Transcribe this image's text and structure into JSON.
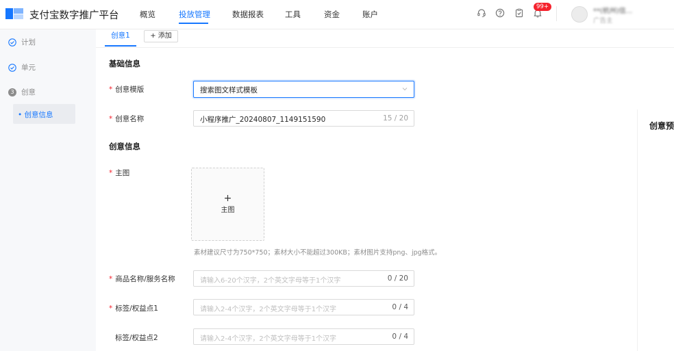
{
  "app": {
    "brand": "支付宝数字推广平台"
  },
  "nav": {
    "items": [
      {
        "label": "概览"
      },
      {
        "label": "投放管理",
        "active": true
      },
      {
        "label": "数据报表"
      },
      {
        "label": "工具"
      },
      {
        "label": "资金"
      },
      {
        "label": "账户"
      }
    ]
  },
  "top_icons": {
    "support": "headset-icon",
    "help": "question-icon",
    "tasks": "clipboard-check-icon",
    "notifications": "bell-icon",
    "badge": "99+"
  },
  "account": {
    "name": "**(杭州)信...",
    "role": "广告主"
  },
  "sidebar": {
    "steps": [
      {
        "label": "计划",
        "state": "done"
      },
      {
        "label": "单元",
        "state": "done"
      },
      {
        "label": "创意",
        "state": "current",
        "num": "3"
      }
    ],
    "sub_item": "• 创意信息"
  },
  "tabs": {
    "active": "创意1",
    "add": "+ 添加"
  },
  "basic": {
    "title": "基础信息",
    "template_label": "创意模版",
    "template_value": "搜索图文样式模板",
    "name_label": "创意名称",
    "name_value": "小程序推广_20240807_1149151590",
    "name_count": "15 / 20"
  },
  "creative": {
    "title": "创意信息",
    "main_image_label": "主图",
    "upload_plus": "+",
    "upload_label": "主图",
    "upload_hint": "素材建议尺寸为750*750；素材大小不能超过300KB；素材图片支持png、jpg格式。",
    "product_label": "商品名称/服务名称",
    "product_placeholder": "请输入6-20个汉字，2个英文字母等于1个汉字",
    "product_count": "0 / 20",
    "tag1_label": "标签/权益点1",
    "tag1_placeholder": "请输入2-4个汉字，2个英文字母等于1个汉字",
    "tag1_count": "0 / 4",
    "tag2_label": "标签/权益点2",
    "tag2_placeholder": "请输入2-4个汉字，2个英文字母等于1个汉字",
    "tag2_count": "0 / 4"
  },
  "preview": {
    "title": "创意预"
  },
  "colors": {
    "accent": "#1677ff",
    "required": "#f5222d",
    "badge": "#f5222d"
  }
}
